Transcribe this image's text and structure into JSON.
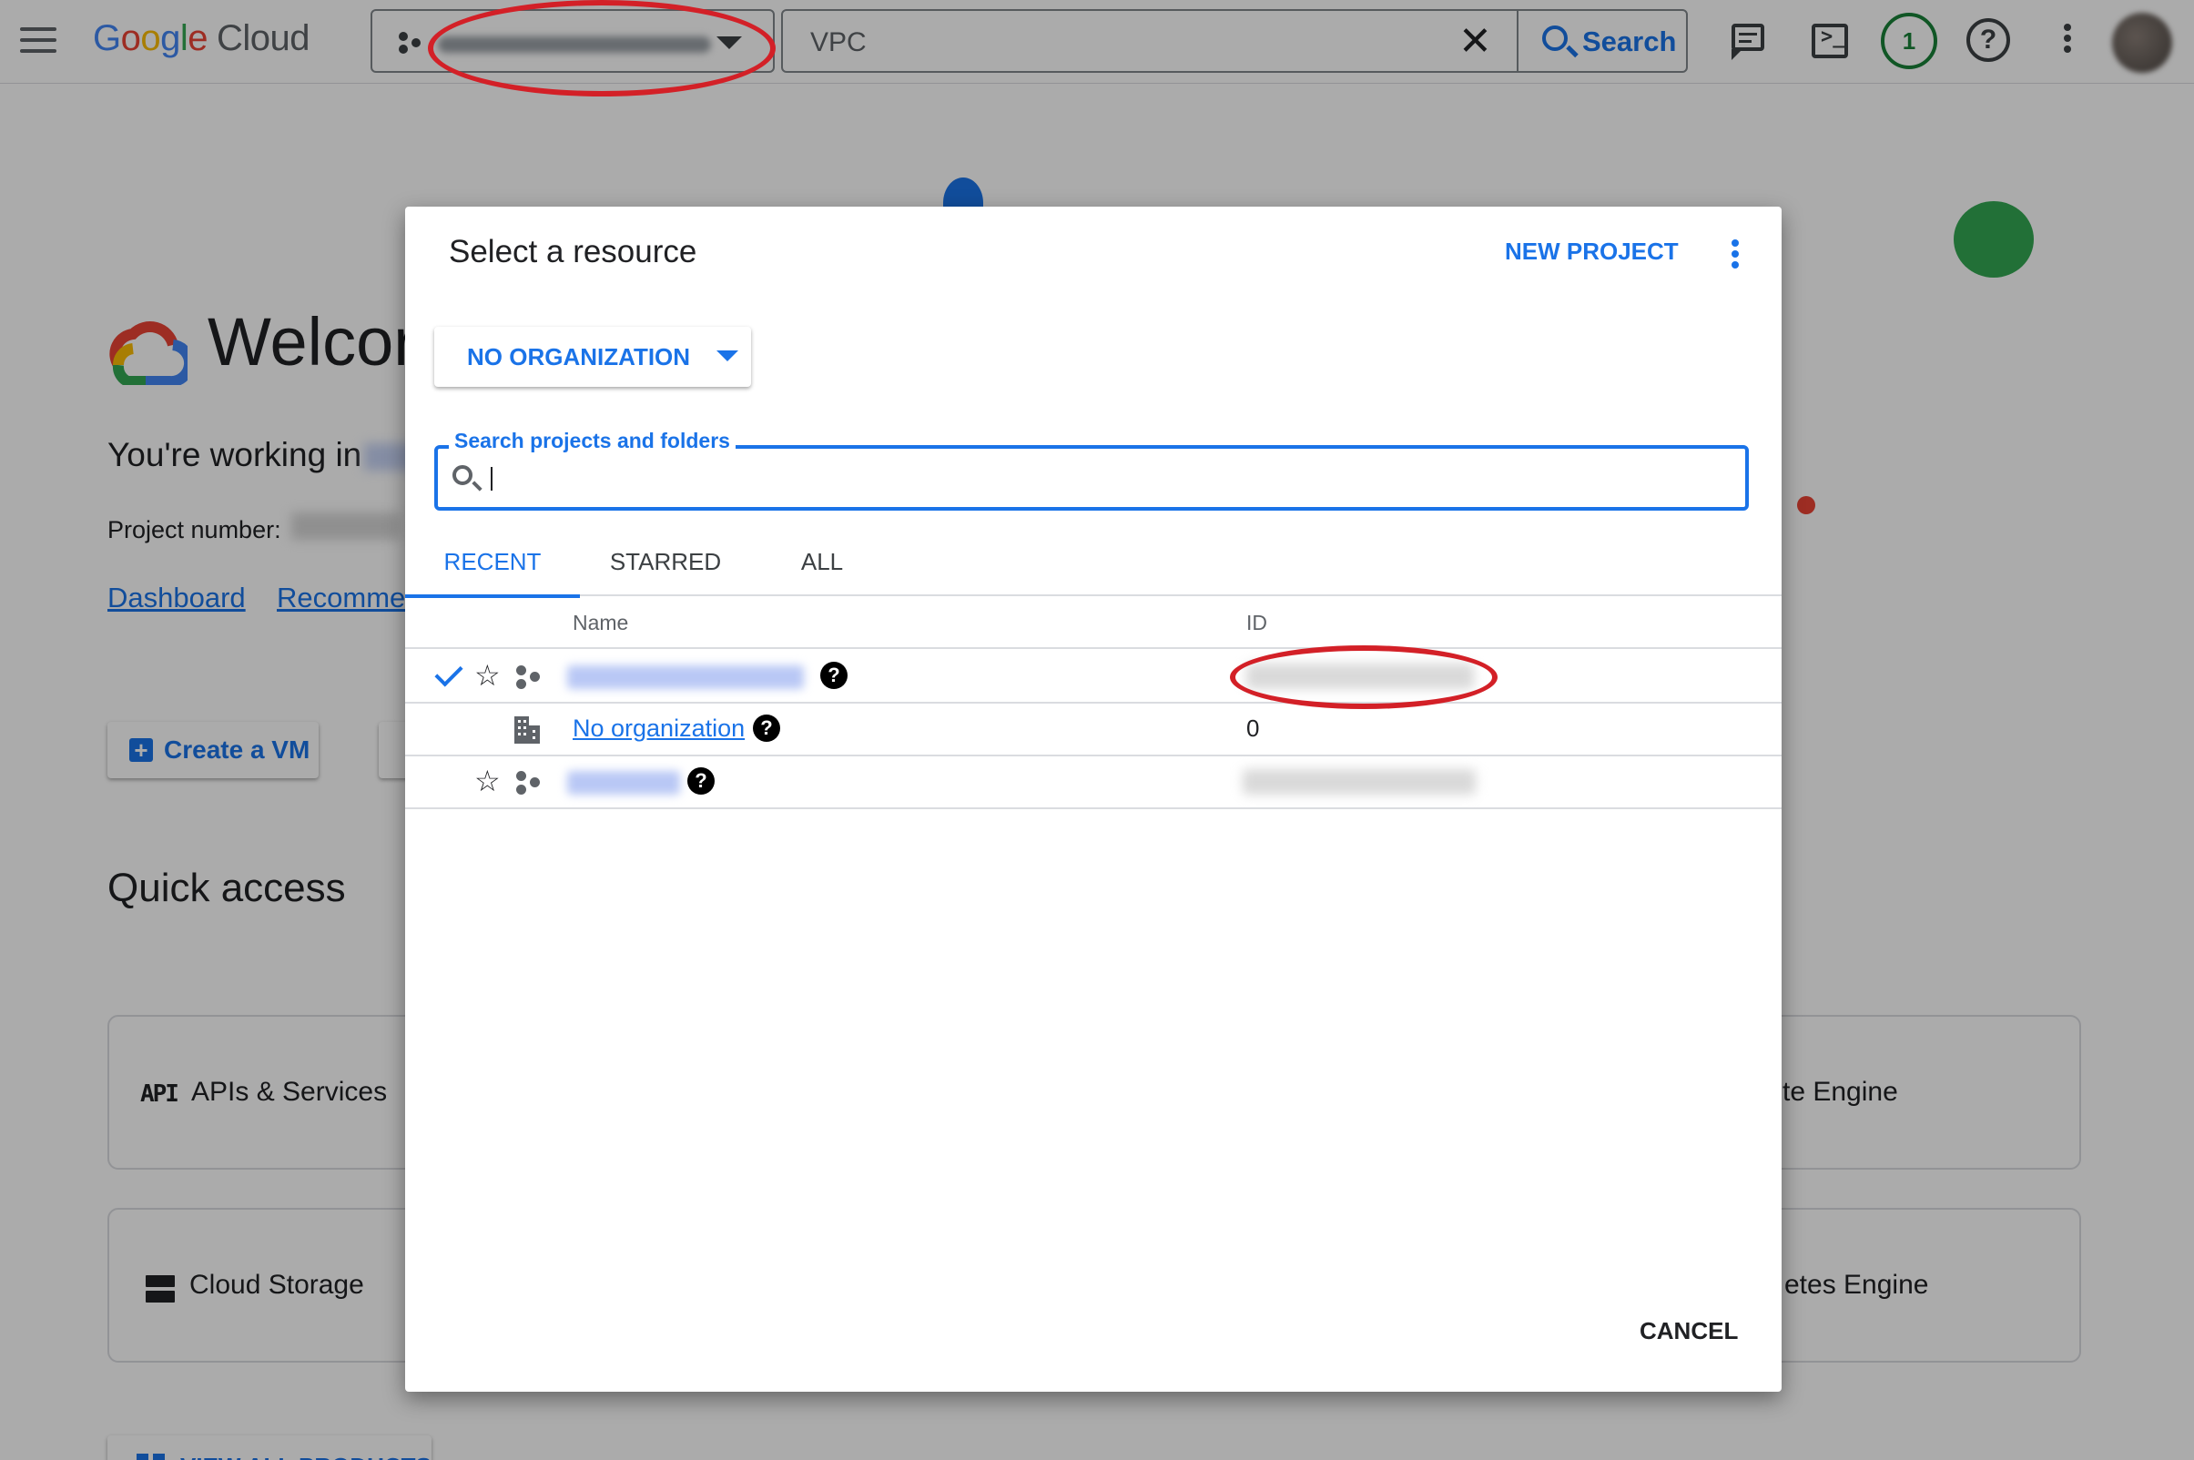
{
  "topbar": {
    "logo": {
      "g1": "G",
      "g2": "o",
      "g3": "o",
      "g4": "g",
      "g5": "l",
      "g6": "e",
      "cloud": "Cloud"
    },
    "search_query": "VPC",
    "search_button": "Search",
    "notification_count": "1",
    "help": "?"
  },
  "background": {
    "welcome": "Welcor",
    "working_in": "You're working in",
    "project_number_label": "Project number:",
    "links": {
      "dashboard": "Dashboard",
      "recommendations": "Recommer"
    },
    "create_vm": "Create a VM",
    "quick_access": "Quick access",
    "cards": {
      "api": "APIs & Services",
      "api_icon": "API",
      "storage": "Cloud Storage",
      "compute": "te Engine",
      "kubernetes": "etes Engine"
    },
    "view_all": "VIEW ALL PRODUCTS"
  },
  "dialog": {
    "title": "Select a resource",
    "new_project": "NEW PROJECT",
    "organization": "NO ORGANIZATION",
    "search_label": "Search projects and folders",
    "tabs": {
      "recent": "RECENT",
      "starred": "STARRED",
      "all": "ALL"
    },
    "columns": {
      "name": "Name",
      "id": "ID"
    },
    "rows": [
      {
        "name": "",
        "id": ""
      },
      {
        "name": "No organization",
        "id": "0"
      },
      {
        "name": "",
        "id": ""
      }
    ],
    "star": "☆",
    "qmark": "?",
    "cancel": "CANCEL"
  },
  "colors": {
    "accent": "#1a73e8",
    "annotation": "#d32027",
    "notification": "#188038"
  }
}
